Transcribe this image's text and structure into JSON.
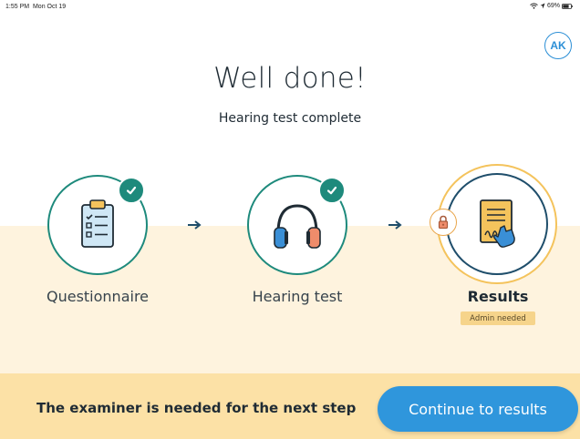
{
  "status_bar": {
    "time": "1:55 PM",
    "date": "Mon Oct 19",
    "battery": "69%"
  },
  "user": {
    "initials": "AK"
  },
  "header": {
    "title": "Well done!",
    "subtitle": "Hearing test complete"
  },
  "steps": [
    {
      "label": "Questionnaire",
      "status": "complete",
      "icon": "clipboard-checklist-icon"
    },
    {
      "label": "Hearing test",
      "status": "complete",
      "icon": "headphones-icon"
    },
    {
      "label": "Results",
      "status": "locked",
      "icon": "signed-document-icon",
      "badge": "Admin needed"
    }
  ],
  "footer": {
    "message": "The examiner is needed for the next step",
    "button_label": "Continue to results"
  },
  "colors": {
    "accent_blue": "#2f96dc",
    "complete_teal": "#1e8a7c",
    "locked_gold": "#f4c35c",
    "band_cream": "#fef3de",
    "footer_yellow": "#fce1a6"
  }
}
